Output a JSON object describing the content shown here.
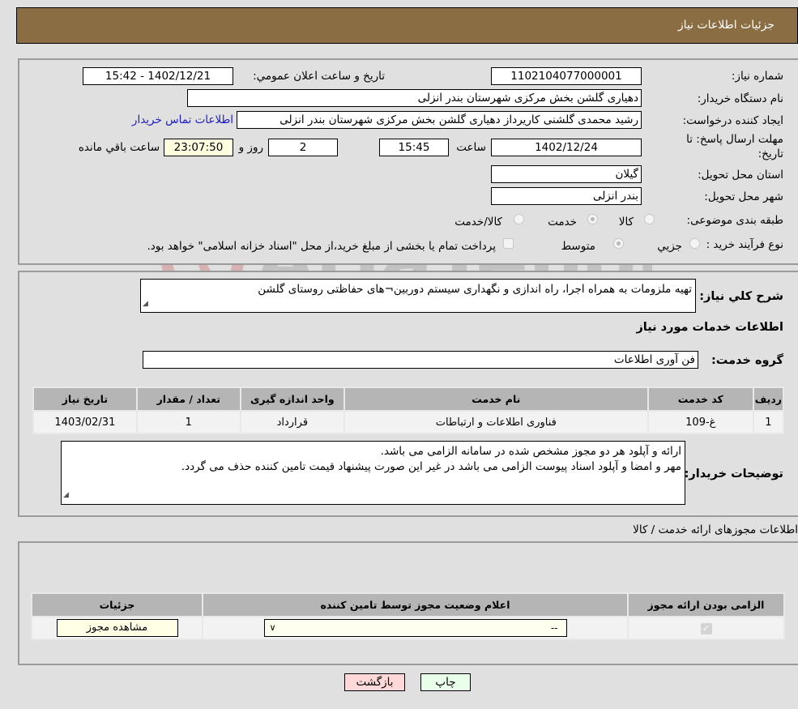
{
  "header": {
    "title": "جزئیات اطلاعات نیاز"
  },
  "details": {
    "need_number_label": "شماره نیاز:",
    "need_number": "1102104077000001",
    "announce_label": "تاریخ و ساعت اعلان عمومي:",
    "announce_value": "1402/12/21 - 15:42",
    "buyer_org_label": "نام دستگاه خریدار:",
    "buyer_org": "دهیاری گلشن بخش مرکزی شهرستان بندر انزلی",
    "creator_label": "ایجاد کننده درخواست:",
    "creator": "رشید محمدی گلشنی کاریرداز دهیاری گلشن بخش مرکزی شهرستان بندر انزلی",
    "contact_link": "اطلاعات تماس خریدار",
    "deadline_label": "مهلت ارسال پاسخ: تا تاریخ:",
    "deadline_date": "1402/12/24",
    "time_label": "ساعت",
    "deadline_time": "15:45",
    "days_value": "2",
    "days_label": "روز و",
    "remaining_time": "23:07:50",
    "remaining_label": "ساعت باقي مانده",
    "province_label": "استان محل تحویل:",
    "province": "گیلان",
    "city_label": "شهر محل تحویل:",
    "city": "بندر انزلی",
    "category_label": "طبقه بندی موضوعی:",
    "category_options": [
      {
        "label": "کالا",
        "checked": false
      },
      {
        "label": "خدمت",
        "checked": true
      },
      {
        "label": "کالا/خدمت",
        "checked": false
      }
    ],
    "process_label": "نوع فرآیند خرید :",
    "process_options": [
      {
        "label": "جزیي",
        "checked": false
      },
      {
        "label": "متوسط",
        "checked": true
      }
    ],
    "treasury_note": "پرداخت تمام یا بخشی از مبلغ خرید،از محل \"اسناد خزانه اسلامی\" خواهد بود.",
    "treasury_checked": false
  },
  "summary": {
    "desc_label": "شرح کلي نیاز:",
    "desc_value": "تهیه ملزومات به همراه اجرا، راه اندازی و نگهداری سیستم دوربین¬های حفاظتی روستای گلشن",
    "services_title": "اطلاعات خدمات مورد نیاز",
    "group_label": "گروه خدمت:",
    "group_value": "فن آوری اطلاعات"
  },
  "services_table": {
    "headers": [
      "ردیف",
      "کد خدمت",
      "نام خدمت",
      "واحد اندازه گیری",
      "تعداد / مقدار",
      "تاریخ نیاز"
    ],
    "rows": [
      [
        "1",
        "غ-109",
        "فناوری اطلاعات و ارتباطات",
        "قرارداد",
        "1",
        "1403/02/31"
      ]
    ]
  },
  "buyer_notes": {
    "label": "توضیحات خریدار:",
    "line1": "ارائه و آپلود هر دو مجوز مشخص شده در سامانه الزامی می باشد.",
    "line2": "مهر و امضا و آپلود اسناد پیوست الزامی می باشد در غیر این صورت پیشنهاد قیمت تامین کننده حذف می گردد."
  },
  "permits": {
    "title": "اطلاعات مجوزهای ارائه خدمت / کالا",
    "headers": [
      "الزامی بودن ارائه مجوز",
      "اعلام وضعیت مجوز توسط تامین کننده",
      "جزئیات"
    ],
    "row": {
      "required_checked": true,
      "status_selected": "--",
      "view_button": "مشاهده مجوز"
    }
  },
  "actions": {
    "print": "چاپ",
    "back": "بازگشت"
  },
  "watermark": {
    "text": "AriaTender.neT"
  },
  "colors": {
    "header_bg": "#8b6d43",
    "print_bg": "#eaffea",
    "back_bg": "#ffd9d9",
    "link": "#1a1acc",
    "highlight_bg": "#ffffe0"
  }
}
